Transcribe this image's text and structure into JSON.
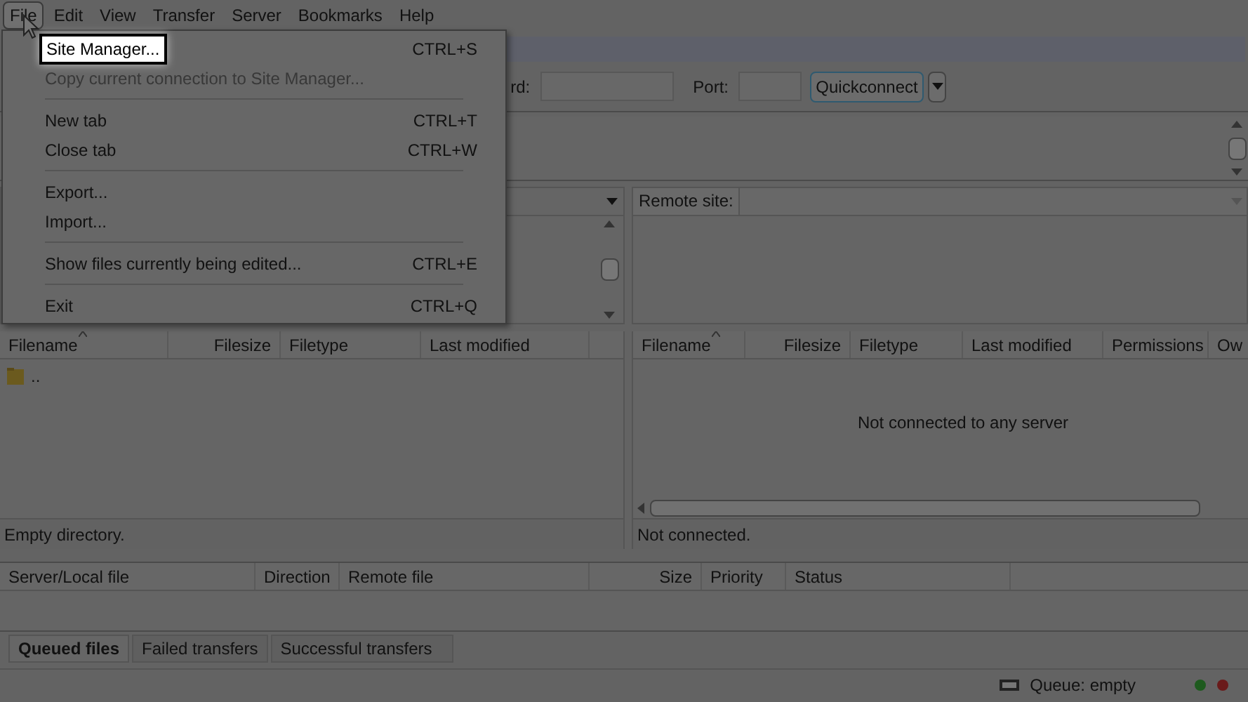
{
  "menubar": [
    {
      "label": "File",
      "selected": true
    },
    {
      "label": "Edit",
      "selected": false
    },
    {
      "label": "View",
      "selected": false
    },
    {
      "label": "Transfer",
      "selected": false
    },
    {
      "label": "Server",
      "selected": false
    },
    {
      "label": "Bookmarks",
      "selected": false
    },
    {
      "label": "Help",
      "selected": false
    }
  ],
  "file_menu": [
    {
      "kind": "item",
      "label": "Site Manager...",
      "shortcut": "CTRL+S",
      "selected": true,
      "disabled": false
    },
    {
      "kind": "item",
      "label": "Copy current connection to Site Manager...",
      "selected": false,
      "disabled": true
    },
    {
      "kind": "separator"
    },
    {
      "kind": "item",
      "label": "New tab",
      "shortcut": "CTRL+T",
      "selected": false,
      "disabled": false
    },
    {
      "kind": "item",
      "label": "Close tab",
      "shortcut": "CTRL+W",
      "selected": false,
      "disabled": false
    },
    {
      "kind": "separator"
    },
    {
      "kind": "item",
      "label": "Export...",
      "selected": false,
      "disabled": false
    },
    {
      "kind": "item",
      "label": "Import...",
      "selected": false,
      "disabled": false
    },
    {
      "kind": "separator"
    },
    {
      "kind": "item",
      "label": "Show files currently being edited...",
      "shortcut": "CTRL+E",
      "selected": false,
      "disabled": false
    },
    {
      "kind": "separator"
    },
    {
      "kind": "item",
      "label": "Exit",
      "shortcut": "CTRL+Q",
      "selected": false,
      "disabled": false
    }
  ],
  "quickconnect": {
    "password_label": "rd:",
    "port_label": "Port:",
    "button": "Quickconnect"
  },
  "remote_site": {
    "label": "Remote site:"
  },
  "local_files": {
    "columns": [
      "Filename",
      "Filesize",
      "Filetype",
      "Last modified"
    ],
    "rows": [
      ".."
    ],
    "status": "Empty directory."
  },
  "remote_files": {
    "columns": [
      "Filename",
      "Filesize",
      "Filetype",
      "Last modified",
      "Permissions",
      "Ow"
    ],
    "message": "Not connected to any server",
    "status": "Not connected."
  },
  "queue": {
    "columns": [
      "Server/Local file",
      "Direction",
      "Remote file",
      "Size",
      "Priority",
      "Status"
    ]
  },
  "queue_tabs": [
    {
      "label": "Queued files",
      "selected": true
    },
    {
      "label": "Failed transfers",
      "selected": false
    },
    {
      "label": "Successful transfers",
      "selected": false
    }
  ],
  "status_bar": {
    "queue": "Queue: empty",
    "lights": [
      {
        "color": "#1e5a1e"
      },
      {
        "color": "#6a1a1a"
      }
    ]
  }
}
